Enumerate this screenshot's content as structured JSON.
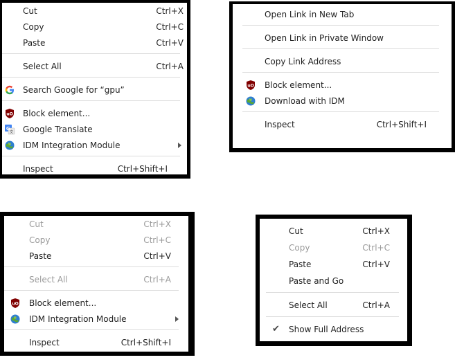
{
  "menu1": {
    "cut": "Cut",
    "cut_shortcut": "Ctrl+X",
    "copy": "Copy",
    "copy_shortcut": "Ctrl+C",
    "paste": "Paste",
    "paste_shortcut": "Ctrl+V",
    "select_all": "Select All",
    "select_all_shortcut": "Ctrl+A",
    "search_google": "Search Google for “gpu”",
    "block_element": "Block element...",
    "google_translate": "Google Translate",
    "idm_module": "IDM Integration Module",
    "inspect": "Inspect",
    "inspect_shortcut": "Ctrl+Shift+I"
  },
  "menu2": {
    "open_new_tab": "Open Link in New Tab",
    "open_private": "Open Link in Private Window",
    "copy_link": "Copy Link Address",
    "block_element": "Block element...",
    "download_idm": "Download with IDM",
    "inspect": "Inspect",
    "inspect_shortcut": "Ctrl+Shift+I"
  },
  "menu3": {
    "cut": "Cut",
    "cut_shortcut": "Ctrl+X",
    "copy": "Copy",
    "copy_shortcut": "Ctrl+C",
    "paste": "Paste",
    "paste_shortcut": "Ctrl+V",
    "select_all": "Select All",
    "select_all_shortcut": "Ctrl+A",
    "block_element": "Block element...",
    "idm_module": "IDM Integration Module",
    "inspect": "Inspect",
    "inspect_shortcut": "Ctrl+Shift+I"
  },
  "menu4": {
    "cut": "Cut",
    "cut_shortcut": "Ctrl+X",
    "copy": "Copy",
    "copy_shortcut": "Ctrl+C",
    "paste": "Paste",
    "paste_shortcut": "Ctrl+V",
    "paste_and_go": "Paste and Go",
    "select_all": "Select All",
    "select_all_shortcut": "Ctrl+A",
    "show_full_address": "Show Full Address"
  },
  "icons": {
    "ublock": "ublock-shield-icon",
    "idm": "idm-globe-icon",
    "google": "google-g-icon",
    "translate": "google-translate-icon",
    "check": "checkmark-icon"
  },
  "colors": {
    "ublock_red": "#800000",
    "google_blue": "#4285f4",
    "disabled_text": "#9a9a9a"
  }
}
